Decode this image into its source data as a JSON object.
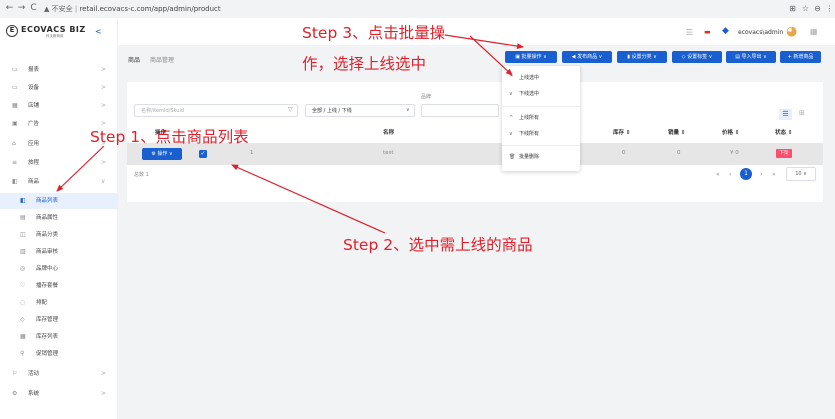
{
  "browser": {
    "back": "←",
    "forward": "→",
    "reload": "C",
    "security": "▲ 不安全",
    "url": "retail.ecovacs-c.com/app/admin/product",
    "icons": {
      "translate": "⊞",
      "star": "☆",
      "profile": "⊖",
      "menu": "⋮"
    }
  },
  "logo": {
    "mark": "E",
    "text": "ECOVACS BIZ",
    "sub": "科沃斯商用"
  },
  "sidebar": {
    "collapse_icon": "<",
    "items": [
      {
        "label": "报表",
        "icon": "▭",
        "arrow": ">"
      },
      {
        "label": "设备",
        "icon": "▭",
        "arrow": ">"
      },
      {
        "label": "店铺",
        "icon": "▦",
        "arrow": ">"
      },
      {
        "label": "广告",
        "icon": "▣",
        "arrow": ">"
      },
      {
        "label": "应用",
        "icon": "⌂",
        "arrow": ">"
      },
      {
        "label": "旅程",
        "icon": "≡",
        "arrow": ">"
      },
      {
        "label": "商品",
        "icon": "◧",
        "arrow": "∨"
      },
      {
        "label": "活动",
        "icon": "⚐",
        "arrow": ">"
      },
      {
        "label": "系统",
        "icon": "⚙",
        "arrow": ">"
      }
    ],
    "subitems": [
      {
        "label": "商品列表",
        "icon": "◧"
      },
      {
        "label": "商品属性",
        "icon": "▤"
      },
      {
        "label": "商品分类",
        "icon": "◫"
      },
      {
        "label": "商品审核",
        "icon": "▥"
      },
      {
        "label": "品牌中心",
        "icon": "◎"
      },
      {
        "label": "播存套餐",
        "icon": "♡"
      },
      {
        "label": "排配",
        "icon": "◌"
      },
      {
        "label": "库存管理",
        "icon": "◇"
      },
      {
        "label": "库存列表",
        "icon": "▦"
      },
      {
        "label": "促销管理",
        "icon": "⚲"
      }
    ]
  },
  "header": {
    "user": "ecovacs\\admin",
    "icons": {
      "layout": "☰",
      "flag": "▬",
      "bell": "◆",
      "avatar": "◕",
      "grid": "▦"
    }
  },
  "breadcrumb": {
    "first": "商品",
    "second": "商品管理"
  },
  "toolbar": {
    "batch": "▣ 批量操作 ∨",
    "publish": "◀ 发布商品 ∨",
    "set_category": "▮ 设置分类 ∨",
    "set_tag": "◇ 设置标签 ∨",
    "import_export": "▤ 导入导出 ∨",
    "add": "+ 新增商品"
  },
  "dropdown": {
    "items": [
      {
        "icon": "^",
        "label": "上线选中"
      },
      {
        "icon": "∨",
        "label": "下线选中"
      },
      {
        "icon": "^",
        "label": "上线所有"
      },
      {
        "icon": "∨",
        "label": "下线所有"
      },
      {
        "icon": "🗑",
        "label": "批量删除"
      }
    ]
  },
  "filters": {
    "search_placeholder": "名称/itemId/Skuid",
    "filter_icon": "▽",
    "status_value": "全部 / 上线 / 下线",
    "status_arrow": "∨",
    "brand_label": "品牌"
  },
  "view_toggle": {
    "list": "☰",
    "grid": "⊞"
  },
  "table": {
    "headers": {
      "op": "操作",
      "name": "名称",
      "stock": "库存 ⇕",
      "sales": "销量 ⇕",
      "price": "价格 ⇕",
      "status": "状态 ⇕"
    },
    "row": {
      "op_button": "⚙ 操作 ∨",
      "check": "✓",
      "index": "1",
      "name": "test",
      "stock": "0",
      "sales": "0",
      "price": "¥ 0",
      "status": "下架"
    },
    "total": "总数 1"
  },
  "pagination": {
    "first": "«",
    "prev": "‹",
    "current": "1",
    "next": "›",
    "last": "»",
    "size": "10 ∨"
  },
  "annotations": {
    "step1": "Step 1、点击商品列表",
    "step2": "Step 2、选中需上线的商品",
    "step3_line1": "Step 3、点击批量操",
    "step3_line2": "作，选择上线选中"
  },
  "colors": {
    "accent": "#1a5fd0",
    "annotation": "#e0202a",
    "status_off": "#ff4d6d"
  }
}
